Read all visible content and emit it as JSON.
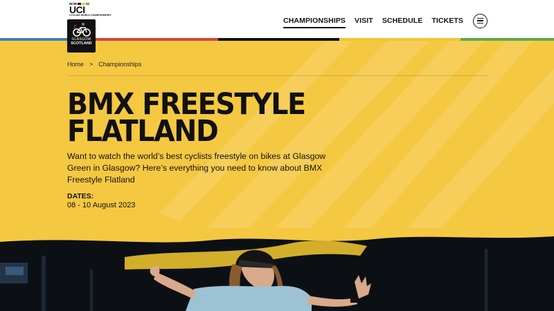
{
  "header": {
    "brand": "UCI",
    "brand_sub": "CYCLING WORLD CHAMPIONSHIPS",
    "logo_line1": "GLASGOW",
    "logo_line2": "SCOTLAND",
    "nav": [
      {
        "label": "CHAMPIONSHIPS",
        "active": true
      },
      {
        "label": "VISIT"
      },
      {
        "label": "SCHEDULE"
      },
      {
        "label": "TICKETS"
      }
    ],
    "menu_icon": "hamburger-menu-icon"
  },
  "breadcrumb": {
    "home": "Home",
    "separator": ">",
    "current": "Championships"
  },
  "hero": {
    "title_line1": "BMX FREESTYLE",
    "title_line2": "FLATLAND",
    "intro": "Want to watch the world’s best cyclists freestyle on bikes at Glasgow Green in Glasgow? Here’s everything you need to know about BMX Freestyle Flatland",
    "dates_label": "DATES:",
    "dates_value": "08 - 10 August 2023"
  },
  "colors": {
    "hero_yellow": "#f5c842",
    "stripe_blue": "#3f7fc4",
    "stripe_red": "#d9443d",
    "stripe_black": "#111111",
    "stripe_yellow": "#f4c430",
    "stripe_green": "#5cab4a"
  }
}
